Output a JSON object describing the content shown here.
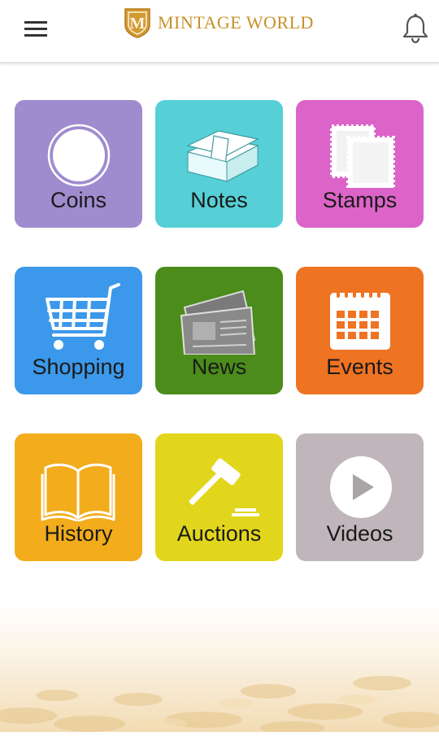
{
  "header": {
    "brand": "MINTAGE WORLD",
    "logo_letter": "M",
    "menu_icon": "hamburger-menu-icon",
    "notification_icon": "bell-icon"
  },
  "tiles": [
    {
      "label": "Coins",
      "color": "#9e8ccf",
      "icon": "coin-icon"
    },
    {
      "label": "Notes",
      "color": "#56d0d6",
      "icon": "banknotes-icon"
    },
    {
      "label": "Stamps",
      "color": "#dc64c8",
      "icon": "stamps-icon"
    },
    {
      "label": "Shopping",
      "color": "#3c98ea",
      "icon": "shopping-cart-icon"
    },
    {
      "label": "News",
      "color": "#4b8c1a",
      "icon": "newspaper-icon"
    },
    {
      "label": "Events",
      "color": "#ee7322",
      "icon": "calendar-icon"
    },
    {
      "label": "History",
      "color": "#f2ac1c",
      "icon": "open-book-icon"
    },
    {
      "label": "Auctions",
      "color": "#e1d61c",
      "icon": "gavel-icon"
    },
    {
      "label": "Videos",
      "color": "#bfb5bb",
      "icon": "play-button-icon"
    }
  ]
}
